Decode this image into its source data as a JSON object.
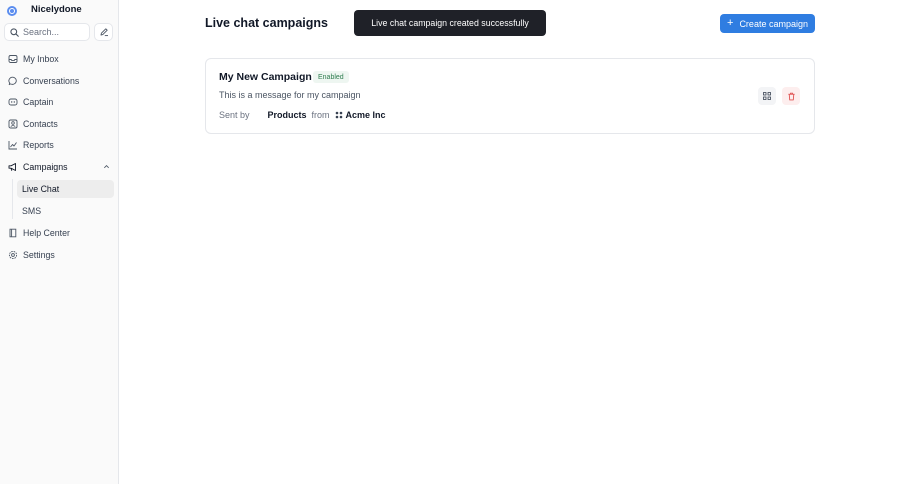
{
  "app": {
    "name": "Nicelydone"
  },
  "sidebar": {
    "search_placeholder": "Search...",
    "items": [
      {
        "label": "My Inbox",
        "icon": "inbox-icon"
      },
      {
        "label": "Conversations",
        "icon": "chat-bubble-icon"
      },
      {
        "label": "Captain",
        "icon": "captain-icon"
      },
      {
        "label": "Contacts",
        "icon": "contacts-icon"
      },
      {
        "label": "Reports",
        "icon": "chart-icon"
      },
      {
        "label": "Campaigns",
        "icon": "megaphone-icon",
        "expanded": true,
        "children": [
          {
            "label": "Live Chat",
            "active": true
          },
          {
            "label": "SMS"
          }
        ]
      },
      {
        "label": "Help Center",
        "icon": "book-icon"
      },
      {
        "label": "Settings",
        "icon": "gear-icon"
      }
    ]
  },
  "main": {
    "title": "Live chat campaigns",
    "create_button": "Create campaign",
    "toast": "Live chat campaign created successfully",
    "campaign": {
      "name": "My New Campaign",
      "status": "Enabled",
      "message": "This is a message for my campaign",
      "sent_by_label": "Sent by",
      "sender": "Products",
      "from_label": "from",
      "inbox": "Acme Inc"
    }
  },
  "colors": {
    "accent": "#2f7de1",
    "toast_bg": "#1f2128",
    "enabled_badge": "#2e7d4f",
    "danger": "#e05252"
  }
}
